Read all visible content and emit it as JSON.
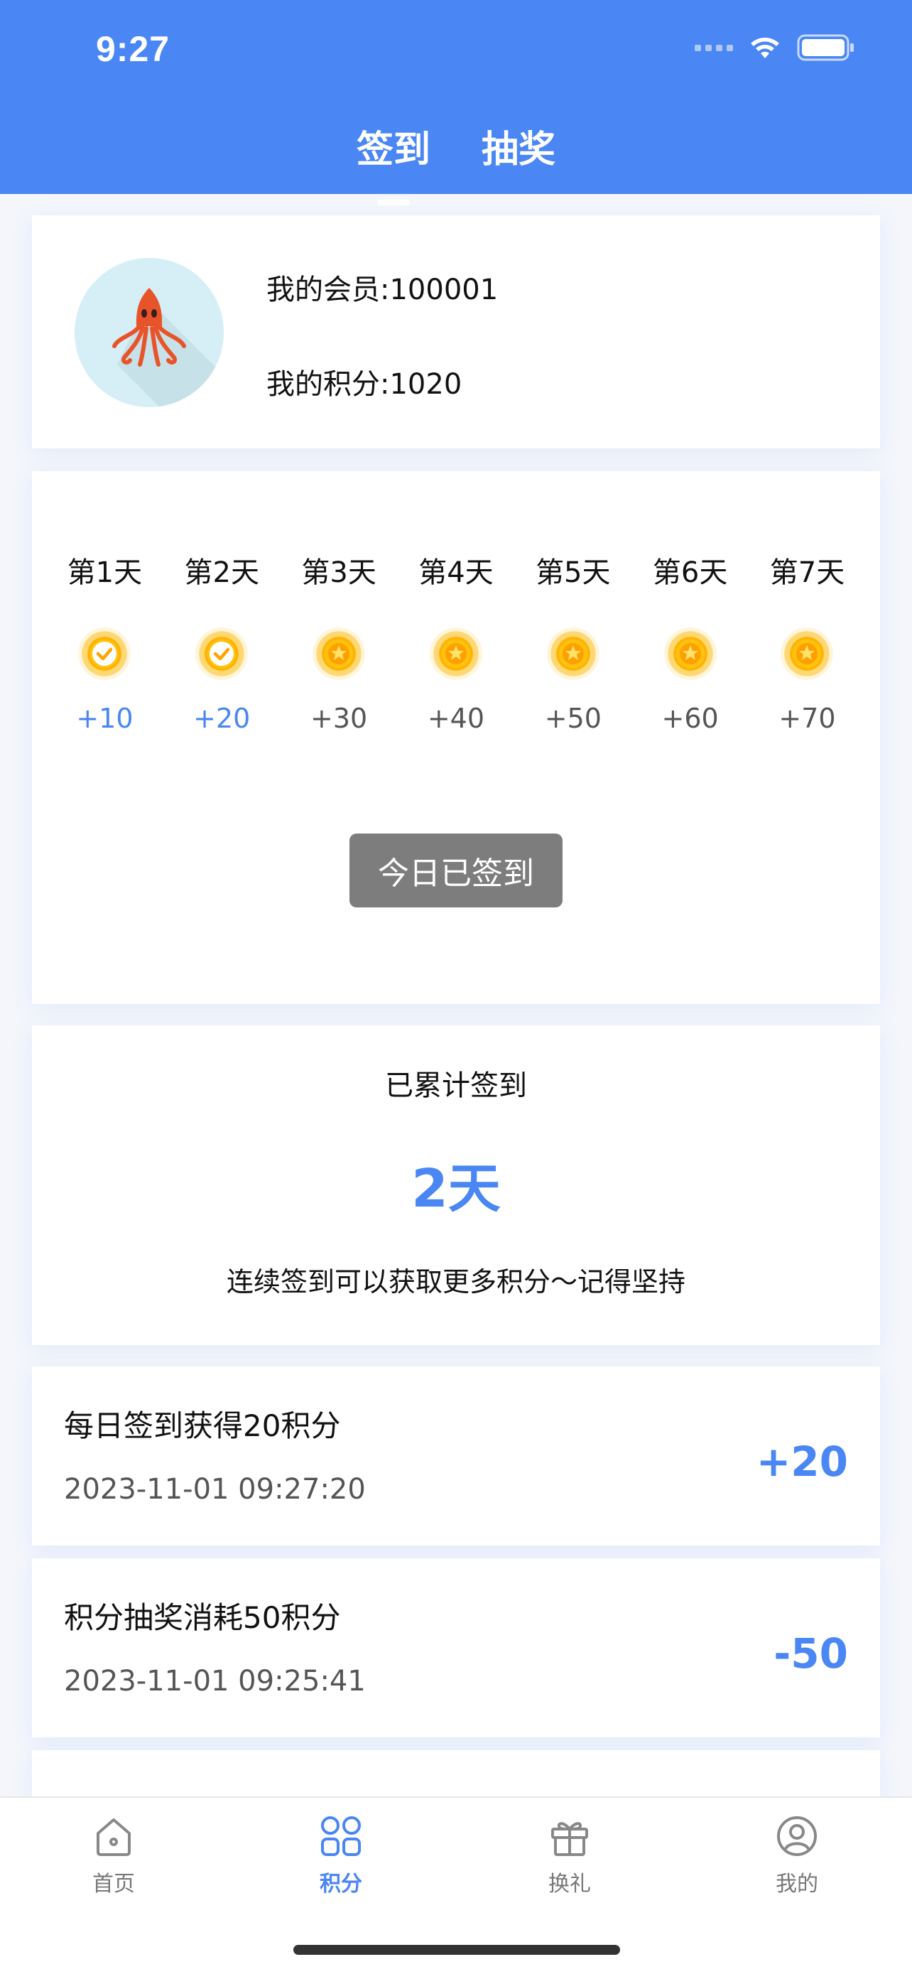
{
  "status_bar": {
    "time": "9:27"
  },
  "tabs": [
    {
      "label": "签到",
      "active": true
    },
    {
      "label": "抽奖",
      "active": false
    }
  ],
  "profile": {
    "member_text": "我的会员:100001",
    "points_text": "我的积分:1020",
    "avatar": "squid-avatar"
  },
  "checkin": {
    "days": [
      {
        "label": "第1天",
        "points": "+10",
        "status": "checked",
        "icon": "check-coin-icon"
      },
      {
        "label": "第2天",
        "points": "+20",
        "status": "checked",
        "icon": "check-coin-icon"
      },
      {
        "label": "第3天",
        "points": "+30",
        "status": "pending",
        "icon": "star-coin-icon"
      },
      {
        "label": "第4天",
        "points": "+40",
        "status": "pending",
        "icon": "star-coin-icon"
      },
      {
        "label": "第5天",
        "points": "+50",
        "status": "pending",
        "icon": "star-coin-icon"
      },
      {
        "label": "第6天",
        "points": "+60",
        "status": "pending",
        "icon": "star-coin-icon"
      },
      {
        "label": "第7天",
        "points": "+70",
        "status": "pending",
        "icon": "star-coin-icon"
      }
    ],
    "button_label": "今日已签到"
  },
  "summary": {
    "title": "已累计签到",
    "days": "2天",
    "tip": "连续签到可以获取更多积分～记得坚持"
  },
  "records": [
    {
      "title": "每日签到获得20积分",
      "time": "2023-11-01 09:27:20",
      "value": "+20"
    },
    {
      "title": "积分抽奖消耗50积分",
      "time": "2023-11-01 09:25:41",
      "value": "-50"
    }
  ],
  "bottom_nav": [
    {
      "label": "首页",
      "icon": "home-icon",
      "active": false
    },
    {
      "label": "积分",
      "icon": "grid-icon",
      "active": true
    },
    {
      "label": "换礼",
      "icon": "gift-icon",
      "active": false
    },
    {
      "label": "我的",
      "icon": "user-icon",
      "active": false
    }
  ],
  "colors": {
    "primary": "#4a86f4",
    "button_disabled": "#7d7d7d",
    "coin": "#ffb300"
  }
}
